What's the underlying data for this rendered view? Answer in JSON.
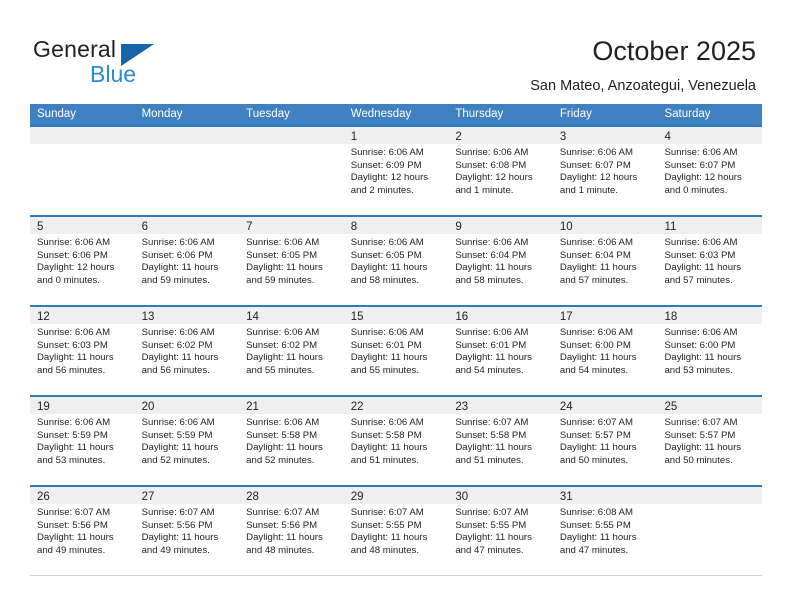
{
  "brand": {
    "name_top": "General",
    "name_bottom": "Blue",
    "accent_color": "#1565a8",
    "accent_color_light": "#2e8bd0"
  },
  "header": {
    "title": "October 2025",
    "subtitle": "San Mateo, Anzoategui, Venezuela"
  },
  "calendar": {
    "header_bg": "#3f80c0",
    "row_rule_color": "#2e7ab8",
    "day_band_bg": "#efefef",
    "weekdays": [
      "Sunday",
      "Monday",
      "Tuesday",
      "Wednesday",
      "Thursday",
      "Friday",
      "Saturday"
    ],
    "weeks": [
      [
        {
          "day": "",
          "lines": []
        },
        {
          "day": "",
          "lines": []
        },
        {
          "day": "",
          "lines": []
        },
        {
          "day": "1",
          "lines": [
            "Sunrise: 6:06 AM",
            "Sunset: 6:09 PM",
            "Daylight: 12 hours",
            "and 2 minutes."
          ]
        },
        {
          "day": "2",
          "lines": [
            "Sunrise: 6:06 AM",
            "Sunset: 6:08 PM",
            "Daylight: 12 hours",
            "and 1 minute."
          ]
        },
        {
          "day": "3",
          "lines": [
            "Sunrise: 6:06 AM",
            "Sunset: 6:07 PM",
            "Daylight: 12 hours",
            "and 1 minute."
          ]
        },
        {
          "day": "4",
          "lines": [
            "Sunrise: 6:06 AM",
            "Sunset: 6:07 PM",
            "Daylight: 12 hours",
            "and 0 minutes."
          ]
        }
      ],
      [
        {
          "day": "5",
          "lines": [
            "Sunrise: 6:06 AM",
            "Sunset: 6:06 PM",
            "Daylight: 12 hours",
            "and 0 minutes."
          ]
        },
        {
          "day": "6",
          "lines": [
            "Sunrise: 6:06 AM",
            "Sunset: 6:06 PM",
            "Daylight: 11 hours",
            "and 59 minutes."
          ]
        },
        {
          "day": "7",
          "lines": [
            "Sunrise: 6:06 AM",
            "Sunset: 6:05 PM",
            "Daylight: 11 hours",
            "and 59 minutes."
          ]
        },
        {
          "day": "8",
          "lines": [
            "Sunrise: 6:06 AM",
            "Sunset: 6:05 PM",
            "Daylight: 11 hours",
            "and 58 minutes."
          ]
        },
        {
          "day": "9",
          "lines": [
            "Sunrise: 6:06 AM",
            "Sunset: 6:04 PM",
            "Daylight: 11 hours",
            "and 58 minutes."
          ]
        },
        {
          "day": "10",
          "lines": [
            "Sunrise: 6:06 AM",
            "Sunset: 6:04 PM",
            "Daylight: 11 hours",
            "and 57 minutes."
          ]
        },
        {
          "day": "11",
          "lines": [
            "Sunrise: 6:06 AM",
            "Sunset: 6:03 PM",
            "Daylight: 11 hours",
            "and 57 minutes."
          ]
        }
      ],
      [
        {
          "day": "12",
          "lines": [
            "Sunrise: 6:06 AM",
            "Sunset: 6:03 PM",
            "Daylight: 11 hours",
            "and 56 minutes."
          ]
        },
        {
          "day": "13",
          "lines": [
            "Sunrise: 6:06 AM",
            "Sunset: 6:02 PM",
            "Daylight: 11 hours",
            "and 56 minutes."
          ]
        },
        {
          "day": "14",
          "lines": [
            "Sunrise: 6:06 AM",
            "Sunset: 6:02 PM",
            "Daylight: 11 hours",
            "and 55 minutes."
          ]
        },
        {
          "day": "15",
          "lines": [
            "Sunrise: 6:06 AM",
            "Sunset: 6:01 PM",
            "Daylight: 11 hours",
            "and 55 minutes."
          ]
        },
        {
          "day": "16",
          "lines": [
            "Sunrise: 6:06 AM",
            "Sunset: 6:01 PM",
            "Daylight: 11 hours",
            "and 54 minutes."
          ]
        },
        {
          "day": "17",
          "lines": [
            "Sunrise: 6:06 AM",
            "Sunset: 6:00 PM",
            "Daylight: 11 hours",
            "and 54 minutes."
          ]
        },
        {
          "day": "18",
          "lines": [
            "Sunrise: 6:06 AM",
            "Sunset: 6:00 PM",
            "Daylight: 11 hours",
            "and 53 minutes."
          ]
        }
      ],
      [
        {
          "day": "19",
          "lines": [
            "Sunrise: 6:06 AM",
            "Sunset: 5:59 PM",
            "Daylight: 11 hours",
            "and 53 minutes."
          ]
        },
        {
          "day": "20",
          "lines": [
            "Sunrise: 6:06 AM",
            "Sunset: 5:59 PM",
            "Daylight: 11 hours",
            "and 52 minutes."
          ]
        },
        {
          "day": "21",
          "lines": [
            "Sunrise: 6:06 AM",
            "Sunset: 5:58 PM",
            "Daylight: 11 hours",
            "and 52 minutes."
          ]
        },
        {
          "day": "22",
          "lines": [
            "Sunrise: 6:06 AM",
            "Sunset: 5:58 PM",
            "Daylight: 11 hours",
            "and 51 minutes."
          ]
        },
        {
          "day": "23",
          "lines": [
            "Sunrise: 6:07 AM",
            "Sunset: 5:58 PM",
            "Daylight: 11 hours",
            "and 51 minutes."
          ]
        },
        {
          "day": "24",
          "lines": [
            "Sunrise: 6:07 AM",
            "Sunset: 5:57 PM",
            "Daylight: 11 hours",
            "and 50 minutes."
          ]
        },
        {
          "day": "25",
          "lines": [
            "Sunrise: 6:07 AM",
            "Sunset: 5:57 PM",
            "Daylight: 11 hours",
            "and 50 minutes."
          ]
        }
      ],
      [
        {
          "day": "26",
          "lines": [
            "Sunrise: 6:07 AM",
            "Sunset: 5:56 PM",
            "Daylight: 11 hours",
            "and 49 minutes."
          ]
        },
        {
          "day": "27",
          "lines": [
            "Sunrise: 6:07 AM",
            "Sunset: 5:56 PM",
            "Daylight: 11 hours",
            "and 49 minutes."
          ]
        },
        {
          "day": "28",
          "lines": [
            "Sunrise: 6:07 AM",
            "Sunset: 5:56 PM",
            "Daylight: 11 hours",
            "and 48 minutes."
          ]
        },
        {
          "day": "29",
          "lines": [
            "Sunrise: 6:07 AM",
            "Sunset: 5:55 PM",
            "Daylight: 11 hours",
            "and 48 minutes."
          ]
        },
        {
          "day": "30",
          "lines": [
            "Sunrise: 6:07 AM",
            "Sunset: 5:55 PM",
            "Daylight: 11 hours",
            "and 47 minutes."
          ]
        },
        {
          "day": "31",
          "lines": [
            "Sunrise: 6:08 AM",
            "Sunset: 5:55 PM",
            "Daylight: 11 hours",
            "and 47 minutes."
          ]
        },
        {
          "day": "",
          "lines": []
        }
      ]
    ]
  }
}
